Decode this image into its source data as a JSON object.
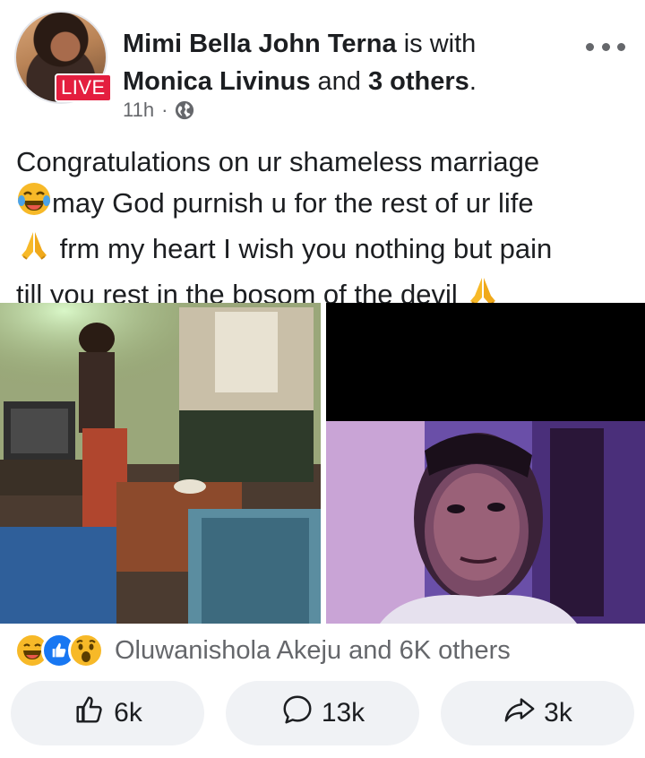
{
  "post": {
    "author": "Mimi Bella John Terna",
    "with_text": "is with",
    "tagged": "Monica Livinus",
    "and_text": "and",
    "others": "3 others",
    "period": ".",
    "live_label": "LIVE",
    "time": "11h",
    "separator": "·",
    "privacy_icon": "globe-icon",
    "menu_icon": "more-icon",
    "text": {
      "line1": "Congratulations on ur shameless marriage",
      "line2": "may God purnish u for the rest of ur life",
      "line3": "frm my heart I wish you nothing but pain",
      "line4": "till you rest in the bosom of the devil"
    }
  },
  "reactions": {
    "icons": [
      "haha-icon",
      "like-icon",
      "wow-icon"
    ],
    "summary": "Oluwanishola Akeju and 6K others"
  },
  "actions": {
    "like": {
      "icon": "thumbs-up-icon",
      "count": "6k"
    },
    "comment": {
      "icon": "comment-icon",
      "count": "13k"
    },
    "share": {
      "icon": "share-icon",
      "count": "3k"
    }
  },
  "colors": {
    "live": "#e41e3f",
    "meta_gray": "#65676b",
    "button_bg": "#f0f2f5",
    "like_blue": "#1877f2",
    "haha_yellow": "#f7b928"
  }
}
